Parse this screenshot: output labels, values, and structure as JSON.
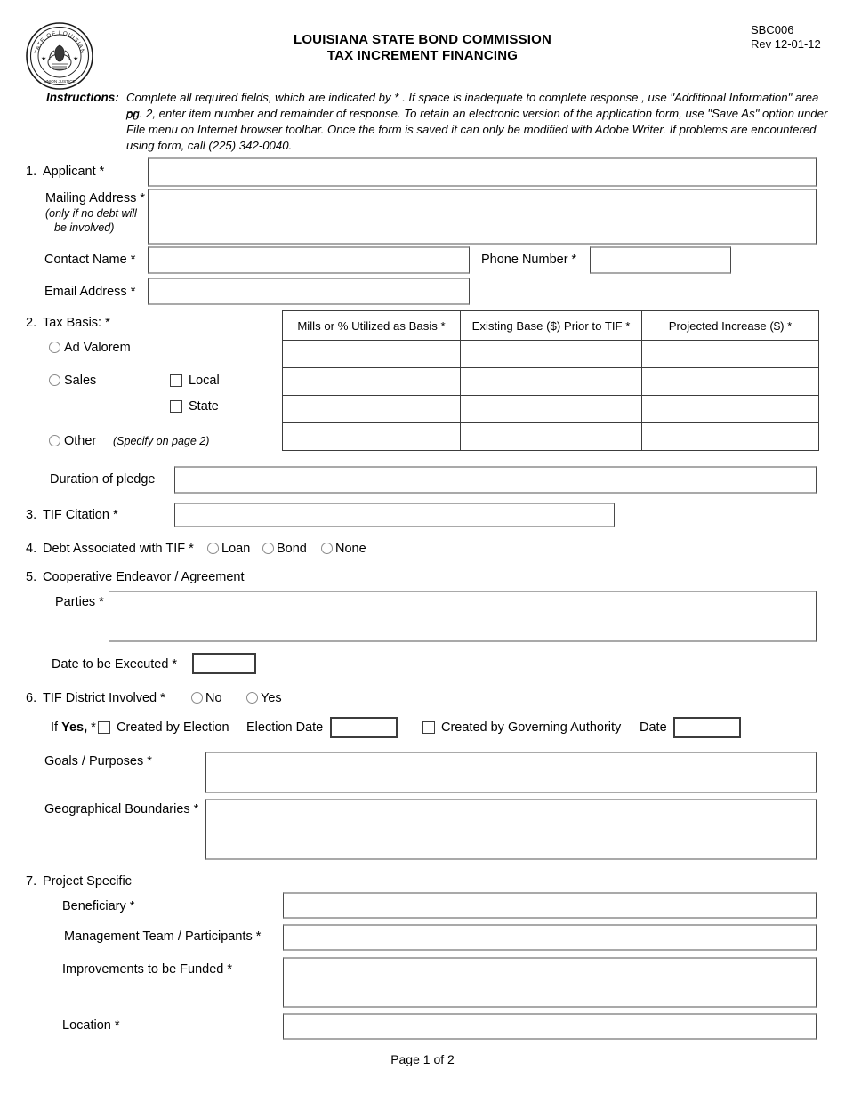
{
  "document": {
    "form_code": "SBC006",
    "revision": "Rev 12-01-12",
    "title_line1": "LOUISIANA STATE BOND COMMISSION",
    "title_line2": "TAX INCREMENT FINANCING",
    "seal_outer_text": "STATE OF LOUISIANA",
    "footer": "Page 1 of 2"
  },
  "instructions": {
    "heading": "Instructions:",
    "line1": "Complete all required fields, which are indicated by * .  If space is inadequate to complete response , use \"Additional Information\" area on",
    "line2": "pg. 2, enter item number and remainder of response.  To retain  an electronic version of the application form, use \"Save As\" option under",
    "line3": "File menu on  Internet browser toolbar.  Once the form is saved it can only be  modified with Adobe Writer.  If problems are encountered",
    "line4": "using form, call (225) 342-0040."
  },
  "section1": {
    "number": "1.",
    "applicant_label": "Applicant *",
    "applicant_value": "",
    "mailing_label": "Mailing Address *",
    "mailing_note1": "(only if no debt will",
    "mailing_note2": "be involved)",
    "mailing_value": "",
    "contact_label": "Contact Name *",
    "contact_value": "",
    "phone_label": "Phone Number *",
    "phone_value": "",
    "email_label": "Email  Address  *",
    "email_value": ""
  },
  "section2": {
    "number": "2.",
    "heading": "Tax Basis: *",
    "option_ad_valorem": "Ad Valorem",
    "option_sales": "Sales",
    "option_other": "Other",
    "other_note": "(Specify on page 2)",
    "check_local": "Local",
    "check_state": "State",
    "table": {
      "headers": [
        "Mills or % Utilized as Basis *",
        "Existing Base ($) Prior to TIF *",
        "Projected Increase ($) *"
      ],
      "rows": [
        [
          "",
          "",
          ""
        ],
        [
          "",
          "",
          ""
        ],
        [
          "",
          "",
          ""
        ],
        [
          "",
          "",
          ""
        ]
      ]
    },
    "duration_label": "Duration of pledge",
    "duration_value": ""
  },
  "section3": {
    "number": "3.",
    "label": "TIF Citation *",
    "value": ""
  },
  "section4": {
    "number": "4.",
    "label": "Debt  Associated with TIF *",
    "options": [
      "Loan",
      "Bond",
      "None"
    ]
  },
  "section5": {
    "number": "5.",
    "heading": "Cooperative Endeavor / Agreement",
    "parties_label": "Parties  *",
    "parties_value": "",
    "date_label": "Date to be Executed *",
    "date_value": ""
  },
  "section6": {
    "number": "6.",
    "heading": "TIF District Involved *",
    "options": [
      "No",
      "Yes"
    ],
    "if_yes_prefix": "If ",
    "if_yes_bold": "Yes,",
    "if_yes_suffix": " *",
    "created_by_election": "Created by Election",
    "election_date_label": "Election Date",
    "election_date_value": "",
    "created_by_governing": "Created by Governing Authority",
    "governing_date_label": "Date",
    "governing_date_value": "",
    "goals_label": "Goals / Purposes *",
    "goals_value": "",
    "boundaries_label": "Geographical Boundaries *",
    "boundaries_value": ""
  },
  "section7": {
    "number": "7.",
    "heading": "Project Specific",
    "beneficiary_label": "Beneficiary *",
    "beneficiary_value": "",
    "management_label": "Management Team / Participants *",
    "management_value": "",
    "improvements_label": "Improvements to be Funded *",
    "improvements_value": "",
    "location_label": "Location *",
    "location_value": ""
  }
}
